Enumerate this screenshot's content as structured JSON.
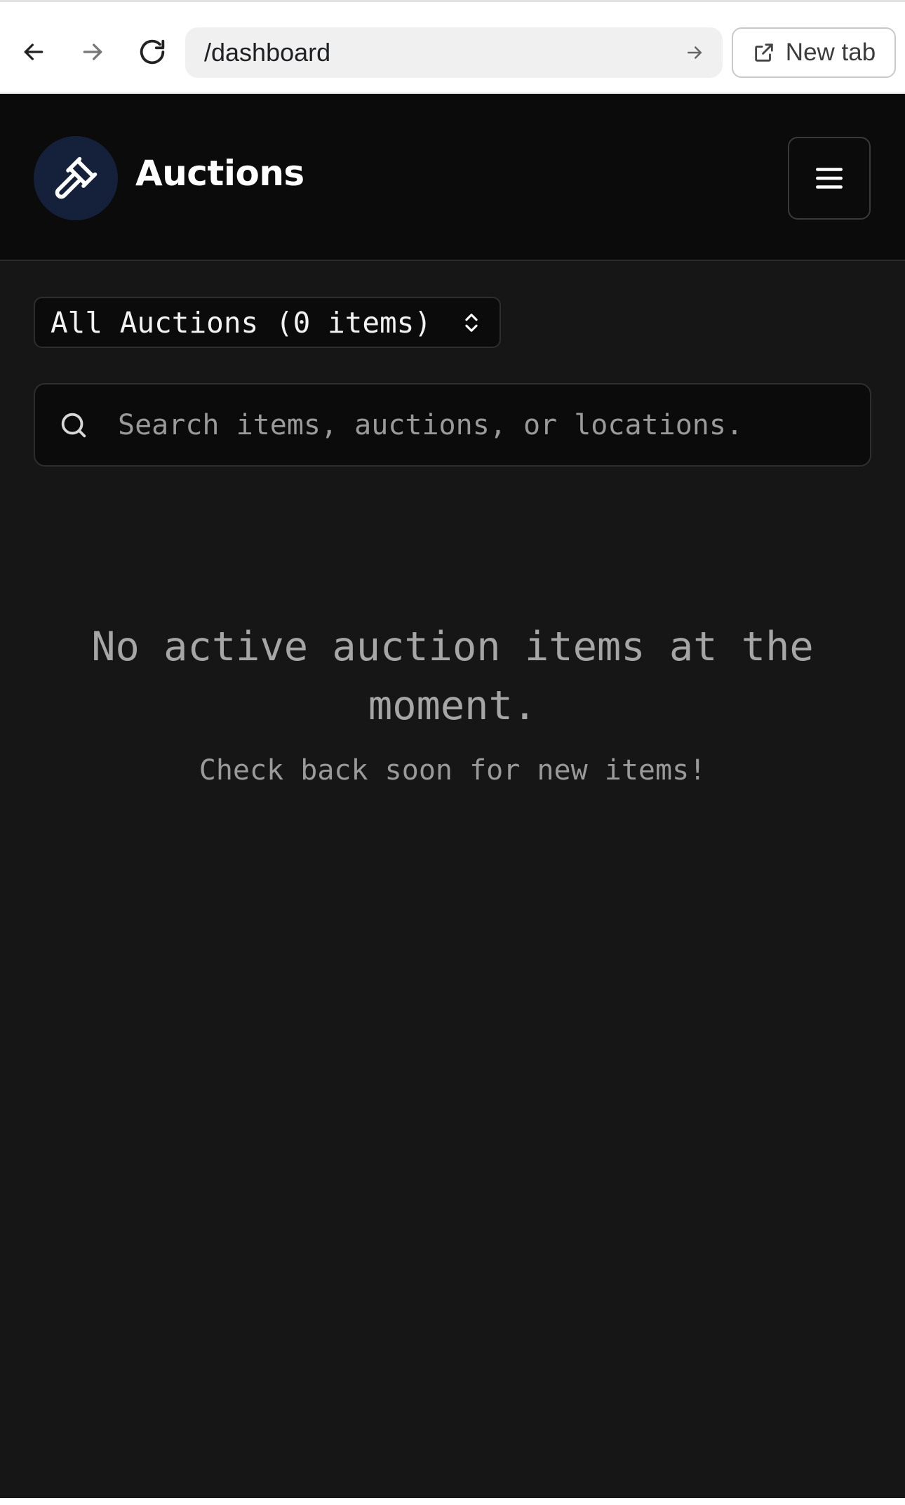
{
  "browser": {
    "url": "/dashboard",
    "new_tab_label": "New tab",
    "icons": [
      "arrow-left-icon",
      "arrow-right-icon",
      "reload-icon",
      "go-arrow-icon",
      "external-link-icon"
    ]
  },
  "header": {
    "brand": "Auctions",
    "logo_icon": "gavel-icon",
    "menu_icon": "hamburger-menu-icon"
  },
  "filter": {
    "selected": "All Auctions (0 items)",
    "icon": "chevrons-up-down-icon"
  },
  "search": {
    "placeholder": "Search items, auctions, or locations.",
    "value": ""
  },
  "empty_state": {
    "title": "No active auction items at the moment.",
    "subtitle": "Check back soon for new items!"
  },
  "colors": {
    "page_bg": "#161617",
    "header_bg": "#0b0b0c",
    "logo_bg": "#15203a",
    "text_primary": "#ffffff",
    "text_muted": "#a6a6a6"
  }
}
